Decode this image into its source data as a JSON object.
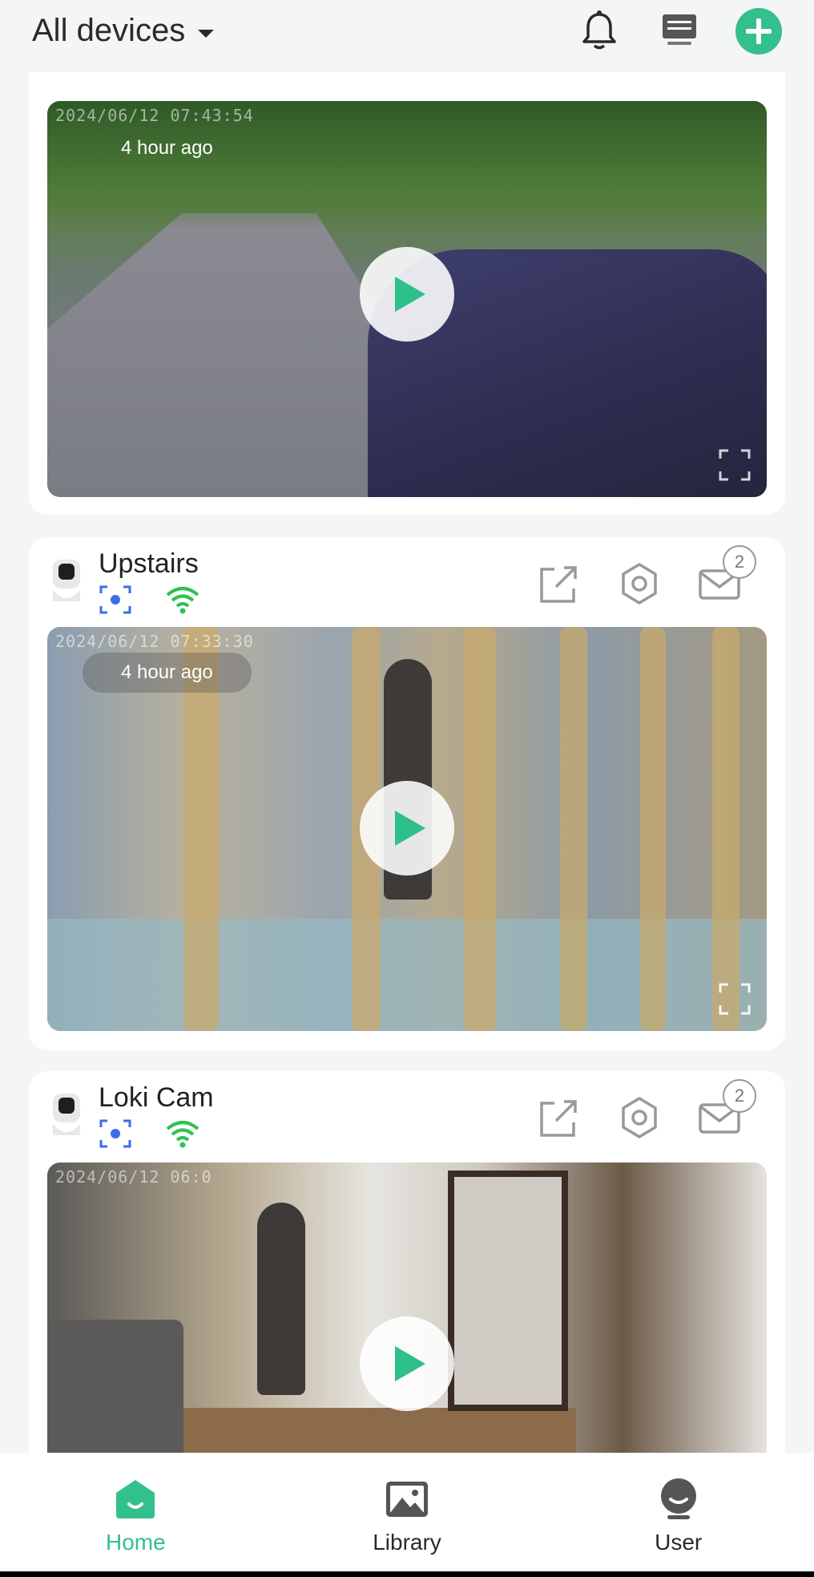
{
  "header": {
    "title": "All devices"
  },
  "colors": {
    "accent": "#33c08c",
    "background": "#f4f5f7"
  },
  "icons": [
    "caret-down-icon",
    "bell-icon",
    "messages-icon",
    "plus-icon",
    "share-icon",
    "gear-icon",
    "mail-icon",
    "motion-detect-icon",
    "wifi-icon",
    "camera-device-icon",
    "play-icon",
    "fullscreen-icon",
    "home-icon",
    "library-icon",
    "user-icon"
  ],
  "cards": [
    {
      "timestamp": "2024/06/12 07:43:54",
      "ago": "4 hour ago"
    },
    {
      "name": "Upstairs",
      "timestamp": "2024/06/12 07:33:30",
      "ago": "4 hour ago",
      "badge": "2"
    },
    {
      "name": "Loki Cam",
      "timestamp": "2024/06/12 06:0",
      "badge": "2"
    }
  ],
  "nav": {
    "home": "Home",
    "library": "Library",
    "user": "User"
  }
}
